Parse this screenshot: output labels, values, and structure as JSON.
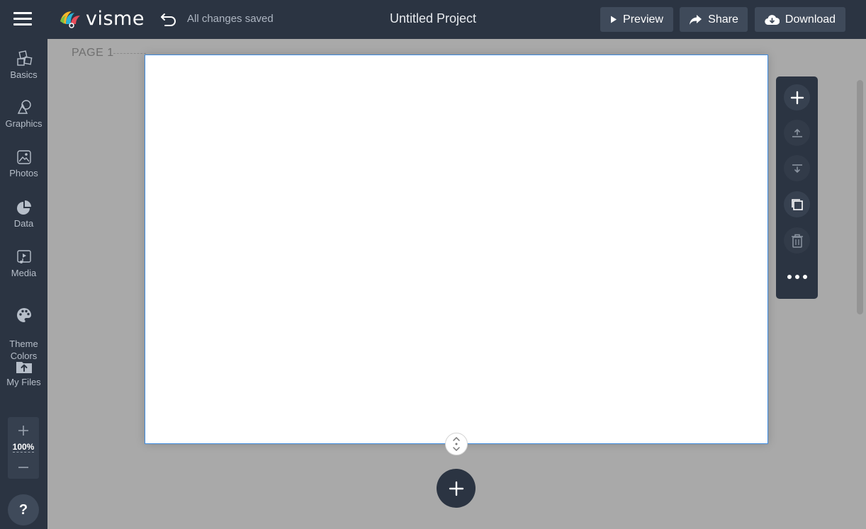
{
  "app": {
    "name": "visme"
  },
  "header": {
    "save_status": "All changes saved",
    "project_title": "Untitled Project",
    "preview_label": "Preview",
    "share_label": "Share",
    "download_label": "Download"
  },
  "sidebar": {
    "items": [
      {
        "label": "Basics",
        "icon": "basics-icon"
      },
      {
        "label": "Graphics",
        "icon": "graphics-icon"
      },
      {
        "label": "Photos",
        "icon": "photos-icon"
      },
      {
        "label": "Data",
        "icon": "data-icon"
      },
      {
        "label": "Media",
        "icon": "media-icon"
      },
      {
        "label": "Theme\nColors",
        "icon": "palette-icon"
      },
      {
        "label": "My Files",
        "icon": "folder-upload-icon"
      }
    ],
    "zoom": "100%",
    "help": "?"
  },
  "canvas": {
    "page_label": "PAGE 1"
  },
  "page_toolbar": {
    "buttons": [
      "add-page-icon",
      "move-up-icon",
      "move-down-icon",
      "duplicate-icon",
      "trash-icon",
      "more-icon"
    ]
  },
  "colors": {
    "chrome": "#2b3442",
    "button": "#3f4a5a",
    "workspace": "#a9a9a9",
    "selection": "#3d8be0"
  }
}
